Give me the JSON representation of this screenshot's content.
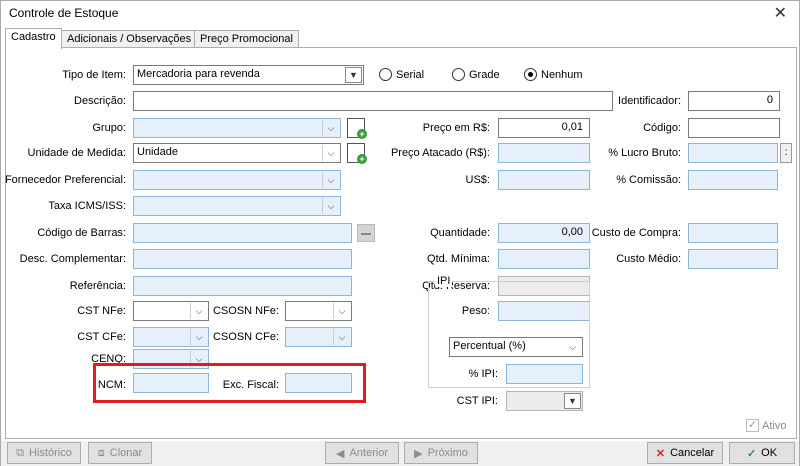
{
  "window": {
    "title": "Controle de Estoque"
  },
  "tabs": [
    {
      "label": "Cadastro",
      "active": true
    },
    {
      "label": "Adicionais / Observações",
      "active": false
    },
    {
      "label": "Preço Promocional",
      "active": false
    }
  ],
  "left": {
    "tipo_item_label": "Tipo de Item:",
    "tipo_item_value": "Mercadoria para revenda",
    "descricao_label": "Descrição:",
    "grupo_label": "Grupo:",
    "unidade_label": "Unidade de Medida:",
    "unidade_value": "Unidade",
    "fornecedor_label": "Fornecedor Preferencial:",
    "taxa_label": "Taxa ICMS/ISS:",
    "barras_label": "Código de Barras:",
    "desc_comp_label": "Desc. Complementar:",
    "referencia_label": "Referência:",
    "cst_nfe_label": "CST NFe:",
    "csosn_nfe_label": "CSOSN NFe:",
    "cst_cfe_label": "CST CFe:",
    "csosn_cfe_label": "CSOSN CFe:",
    "cenq_label": "CENQ:",
    "ncm_label": "NCM:",
    "exc_fiscal_label": "Exc. Fiscal:"
  },
  "radios": [
    {
      "label": "Serial",
      "checked": false
    },
    {
      "label": "Grade",
      "checked": false
    },
    {
      "label": "Nenhum",
      "checked": true
    }
  ],
  "middle": {
    "preco_label": "Preço em R$:",
    "preco_value": "0,01",
    "atacado_label": "Preço Atacado (R$):",
    "uss_label": "US$:",
    "quantidade_label": "Quantidade:",
    "quantidade_value": "0,00",
    "qtd_min_label": "Qtd. Mínima:",
    "qtd_reserva_label": "Qtd. Reserva:",
    "peso_label": "Peso:"
  },
  "ipi": {
    "title": "IPI",
    "tipo_value": "Percentual (%)",
    "pct_label": "% IPI:",
    "cst_label": "CST IPI:"
  },
  "right": {
    "identificador_label": "Identificador:",
    "identificador_value": "0",
    "codigo_label": "Código:",
    "lucro_label": "% Lucro Bruto:",
    "comissao_label": "% Comissão:",
    "custo_compra_label": "Custo de Compra:",
    "custo_medio_label": "Custo Médio:",
    "ativo_label": "Ativo"
  },
  "buttons": {
    "historico": "Histórico",
    "clonar": "Clonar",
    "anterior": "Anterior",
    "proximo": "Próximo",
    "cancelar": "Cancelar",
    "ok": "OK"
  },
  "colors": {
    "highlight": "#e11b22",
    "field_blue": "#e6f0fb"
  }
}
